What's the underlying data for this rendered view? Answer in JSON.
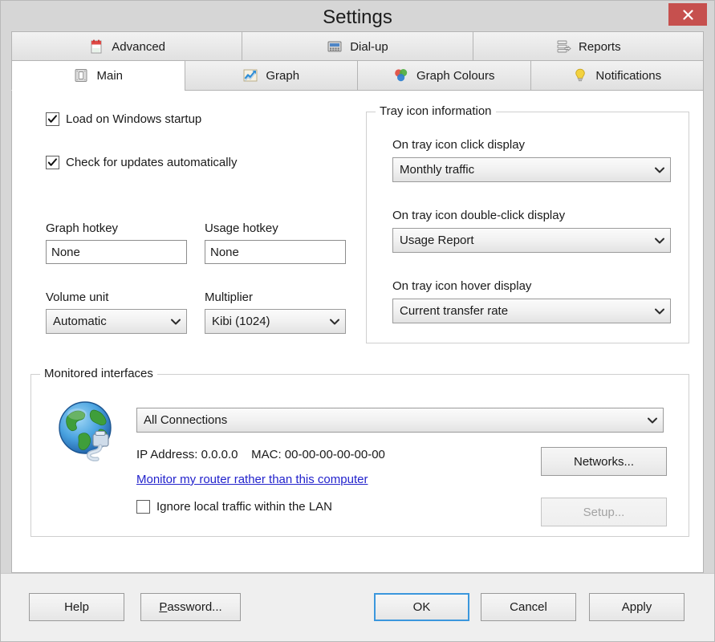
{
  "window": {
    "title": "Settings",
    "close_label": "✕"
  },
  "tabs_row1": [
    {
      "label": "Advanced",
      "icon": "clipboard-icon",
      "active": false
    },
    {
      "label": "Dial-up",
      "icon": "modem-icon",
      "active": false
    },
    {
      "label": "Reports",
      "icon": "reports-icon",
      "active": false
    }
  ],
  "tabs_row2": [
    {
      "label": "Main",
      "icon": "switch-icon",
      "active": true
    },
    {
      "label": "Graph",
      "icon": "line-chart-icon",
      "active": false
    },
    {
      "label": "Graph Colours",
      "icon": "color-circles-icon",
      "active": false
    },
    {
      "label": "Notifications",
      "icon": "lightbulb-icon",
      "active": false
    }
  ],
  "main": {
    "startup_checkbox": {
      "label": "Load on Windows startup",
      "checked": true
    },
    "updates_checkbox": {
      "label": "Check for updates automatically",
      "checked": true
    },
    "graph_hotkey": {
      "label": "Graph hotkey",
      "value": "None"
    },
    "usage_hotkey": {
      "label": "Usage hotkey",
      "value": "None"
    },
    "volume_unit": {
      "label": "Volume unit",
      "value": "Automatic"
    },
    "multiplier": {
      "label": "Multiplier",
      "value": "Kibi (1024)"
    }
  },
  "tray": {
    "group_title": "Tray icon information",
    "click_label": "On tray icon click display",
    "click_value": "Monthly traffic",
    "double_click_label": "On tray icon double-click display",
    "double_click_value": "Usage Report",
    "hover_label": "On tray icon hover display",
    "hover_value": "Current transfer rate"
  },
  "interfaces": {
    "group_title": "Monitored interfaces",
    "connection_value": "All Connections",
    "ip_line": "IP Address: 0.0.0.0    MAC: 00-00-00-00-00-00",
    "router_link": "Monitor my router rather than this computer",
    "ignore_lan": {
      "label": "Ignore local traffic within the LAN",
      "checked": false
    },
    "networks_button": "Networks...",
    "setup_button": "Setup...",
    "setup_disabled": true
  },
  "footer": {
    "help": "Help",
    "password_prefix": "P",
    "password_rest": "assword...",
    "ok": "OK",
    "cancel": "Cancel",
    "apply": "Apply"
  },
  "colors": {
    "close_red": "#c6504e",
    "link_blue": "#2222cc",
    "focus_blue": "#3b97dd",
    "dialog_grey": "#d6d6d6"
  }
}
